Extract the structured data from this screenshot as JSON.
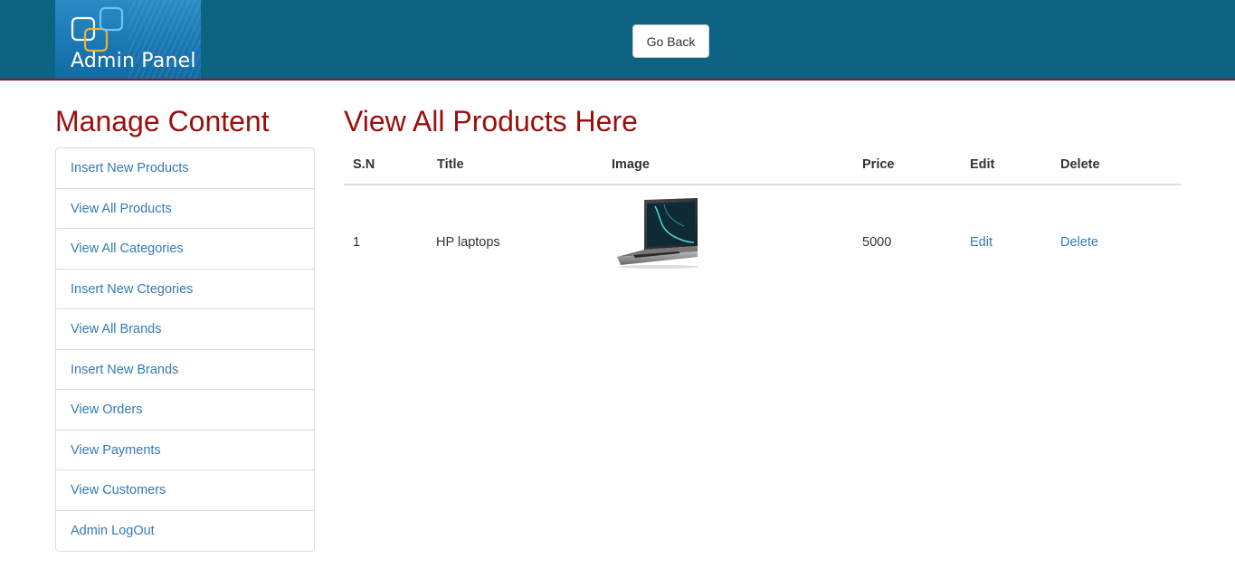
{
  "header": {
    "logo_text": "Admin Panel",
    "go_back_label": "Go Back",
    "colors": {
      "bar": "#0c6382",
      "accent_line": "#a40f14"
    }
  },
  "sidebar": {
    "title": "Manage Content",
    "items": [
      {
        "label": "Insert New Products"
      },
      {
        "label": "View All Products"
      },
      {
        "label": "View All Categories"
      },
      {
        "label": "Insert New Ctegories"
      },
      {
        "label": "View All Brands"
      },
      {
        "label": "Insert New Brands"
      },
      {
        "label": "View Orders"
      },
      {
        "label": "View Payments"
      },
      {
        "label": "View Customers"
      },
      {
        "label": "Admin LogOut"
      }
    ]
  },
  "main": {
    "title": "View All Products Here",
    "columns": [
      "S.N",
      "Title",
      "Image",
      "Price",
      "Edit",
      "Delete"
    ],
    "rows": [
      {
        "sn": "1",
        "title": "HP laptops",
        "image_icon": "laptop-image",
        "price": "5000",
        "edit": "Edit",
        "delete": "Delete"
      }
    ]
  },
  "theme": {
    "heading_color": "#9b0e0e",
    "link_color": "#337ab7"
  }
}
